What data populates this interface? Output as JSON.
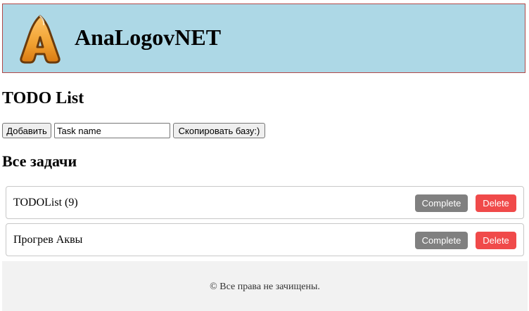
{
  "header": {
    "logo_letter": "A",
    "site_title": "AnaLogovNET"
  },
  "page": {
    "heading": "TODO List"
  },
  "controls": {
    "add_label": "Добавить",
    "task_input_value": "Task name",
    "copy_label": "Скопировать базу:)"
  },
  "tasks_section": {
    "heading": "Все задачи",
    "complete_label": "Complete",
    "delete_label": "Delete",
    "items": [
      {
        "name": "TODOList (9)"
      },
      {
        "name": "Прогрев Аквы"
      }
    ]
  },
  "footer": {
    "text": "© Все права не зачищены."
  },
  "colors": {
    "header_bg": "#add8e6",
    "complete_btn": "#808080",
    "delete_btn": "#f04a4a",
    "footer_bg": "#f2f2f2",
    "logo_orange": "#f0a030"
  }
}
